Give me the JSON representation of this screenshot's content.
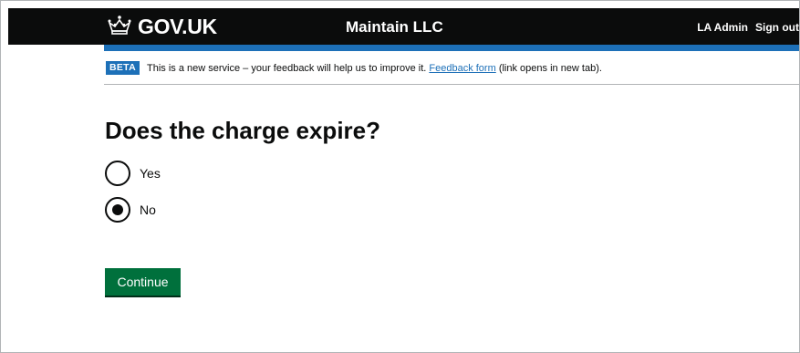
{
  "header": {
    "logo_text": "GOV.UK",
    "service_name": "Maintain LLC",
    "nav": [
      "LA Admin",
      "Sign out"
    ]
  },
  "phase_banner": {
    "tag": "BETA",
    "text_before": "This is a new service – your feedback will help us to improve it.",
    "link_text": "Feedback form",
    "text_after": "(link opens in new tab)."
  },
  "question": {
    "heading": "Does the charge expire?",
    "options": [
      {
        "label": "Yes",
        "checked": false
      },
      {
        "label": "No",
        "checked": true
      }
    ]
  },
  "actions": {
    "continue_label": "Continue"
  },
  "colors": {
    "header_bg": "#0b0c0c",
    "accent_blue": "#1d70b8",
    "button_green": "#00703c"
  },
  "icons": {
    "logo": "crown-icon"
  }
}
